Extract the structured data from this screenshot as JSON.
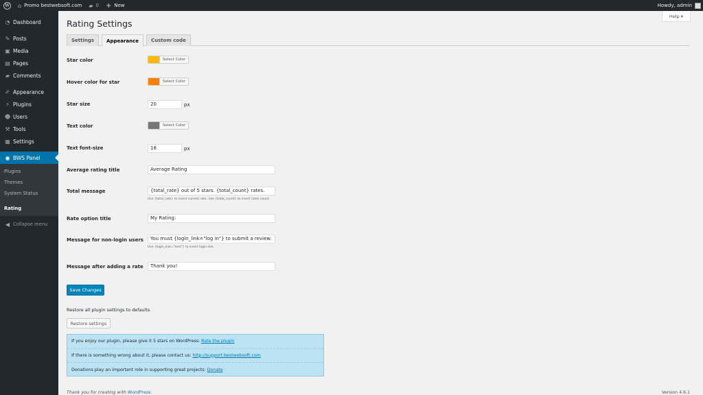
{
  "adminbar": {
    "site_name": "Promo bestwebsoft.com",
    "comments_count": "0",
    "new_label": "New",
    "howdy": "Howdy, admin"
  },
  "sidebar": {
    "items": [
      {
        "label": "Dashboard",
        "icon": "dashboard-icon"
      },
      {
        "label": "Posts",
        "icon": "pin-icon"
      },
      {
        "label": "Media",
        "icon": "media-icon"
      },
      {
        "label": "Pages",
        "icon": "pages-icon"
      },
      {
        "label": "Comments",
        "icon": "comment-icon"
      },
      {
        "label": "Appearance",
        "icon": "brush-icon"
      },
      {
        "label": "Plugins",
        "icon": "plugin-icon"
      },
      {
        "label": "Users",
        "icon": "user-icon"
      },
      {
        "label": "Tools",
        "icon": "wrench-icon"
      },
      {
        "label": "Settings",
        "icon": "settings-icon"
      }
    ],
    "bws_panel": "BWS Panel",
    "submenu": [
      "Plugins",
      "Themes",
      "System Status",
      "Rating"
    ],
    "collapse": "Collapse menu"
  },
  "help": "Help ▾",
  "page": {
    "title": "Rating Settings",
    "tabs": [
      "Settings",
      "Appearance",
      "Custom code"
    ]
  },
  "form": {
    "star_color": {
      "label": "Star color",
      "color": "#ffb900",
      "button": "Select Color"
    },
    "hover_color": {
      "label": "Hover color for star",
      "color": "#ff7f00",
      "button": "Select Color"
    },
    "star_size": {
      "label": "Star size",
      "value": "20",
      "unit": "px"
    },
    "text_color": {
      "label": "Text color",
      "color": "#777777",
      "button": "Select Color"
    },
    "text_font_size": {
      "label": "Text font-size",
      "value": "18",
      "unit": "px"
    },
    "average_title": {
      "label": "Average rating title",
      "value": "Average Rating"
    },
    "total_message": {
      "label": "Total message",
      "value": "{total_rate} out of 5 stars. {total_count} rates.",
      "desc": "Use {total_rate} to insert current rate. Use {total_count} to insert rates count."
    },
    "rate_option_title": {
      "label": "Rate option title",
      "value": "My Rating:"
    },
    "non_login_message": {
      "label": "Message for non-login users",
      "value": "You must {login_link=\"log in\"} to submit a review.",
      "desc": "Use {login_link=\"text\"} to insert login link."
    },
    "after_rate_message": {
      "label": "Message after adding a rate",
      "value": "Thank you!"
    }
  },
  "buttons": {
    "save": "Save Changes",
    "restore_text": "Restore all plugin settings to defaults",
    "restore": "Restore settings"
  },
  "notice": {
    "line1_text": "If you enjoy our plugin, please give it 5 stars on WordPress:",
    "line1_link": "Rate the plugin",
    "line2_text": "If there is something wrong about it, please contact us:",
    "line2_link": "http://support.bestwebsoft.com",
    "line3_text": "Donations play an important role in supporting great projects:",
    "line3_link": "Donate"
  },
  "footer": {
    "thanks": "Thank you for creating with",
    "wp_link": "WordPress.",
    "version": "Version 4.6.1"
  }
}
